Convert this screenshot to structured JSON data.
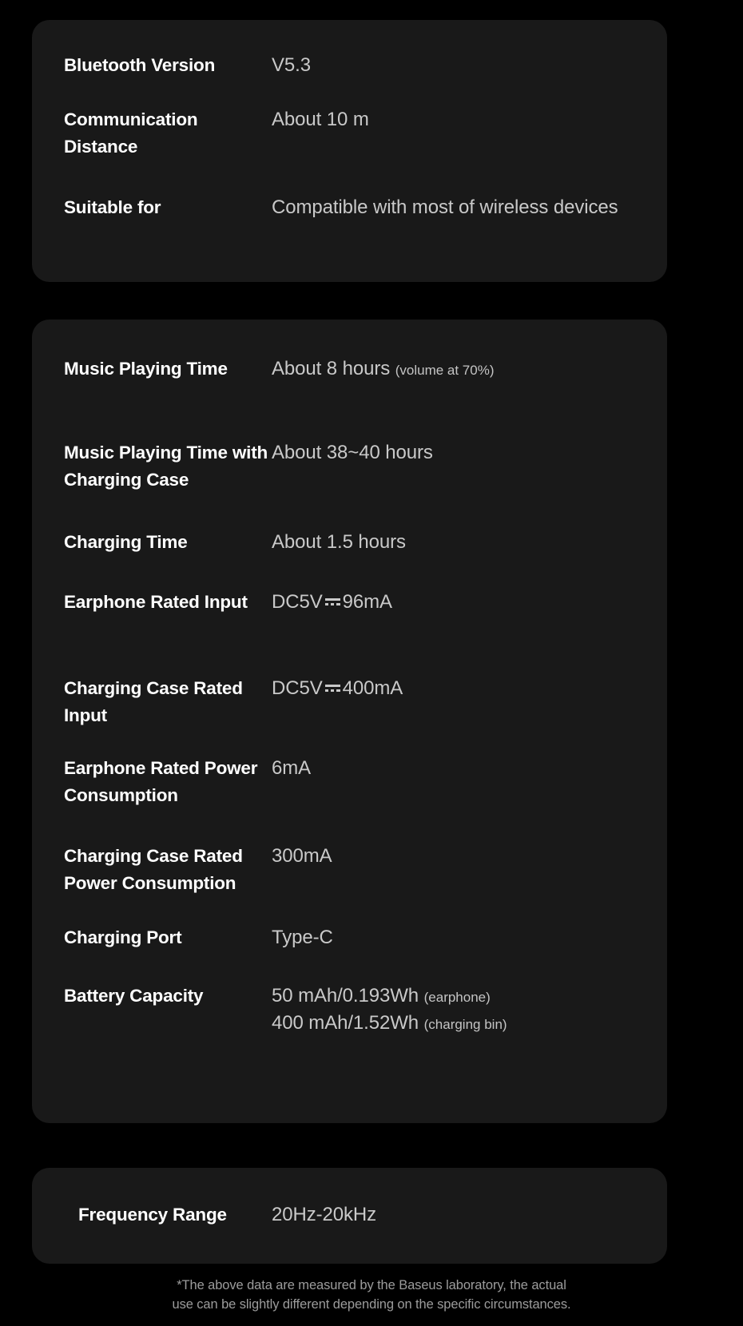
{
  "cards": {
    "specs": {
      "rows": [
        {
          "label": "Bluetooth Version",
          "value": "V5.3"
        },
        {
          "label": "Communication Distance",
          "value": "About 10 m"
        },
        {
          "label": "Suitable for",
          "value": "Compatible with most of wireless devices"
        }
      ]
    },
    "battery": {
      "rows": [
        {
          "label": "Music Playing Time",
          "value": "About 8 hours",
          "note": "(volume at 70%)"
        },
        {
          "label": "Music Playing Time with Charging Case",
          "value": "About 38~40 hours"
        },
        {
          "label": "Charging Time",
          "value": "About 1.5 hours"
        },
        {
          "label": "Earphone Rated Input",
          "value_prefix": "DC5V",
          "value_suffix": "96mA",
          "dc_symbol": "direct-current-mark"
        },
        {
          "label": "Charging Case Rated Input",
          "value_prefix": "DC5V",
          "value_suffix": "400mA",
          "dc_symbol": "direct-current-mark"
        },
        {
          "label": "Earphone Rated Power Consumption",
          "value": "6mA"
        },
        {
          "label": "Charging Case Rated Power Consumption",
          "value": "300mA"
        },
        {
          "label": "Charging Port",
          "value": "Type-C"
        },
        {
          "label": "Battery Capacity",
          "line1_value": "50 mAh/0.193Wh",
          "line1_note": "(earphone)",
          "line2_value": "400 mAh/1.52Wh",
          "line2_note": "(charging bin)"
        }
      ]
    },
    "frequency": {
      "rows": [
        {
          "label": "Frequency Range",
          "value": "20Hz-20kHz"
        }
      ]
    }
  },
  "footnote": {
    "line1": "*The above data are measured by the Baseus laboratory, the actual",
    "line2": "use can be slightly different depending on the specific circumstances."
  },
  "colors": {
    "page_background": "#000000",
    "card_background": "#191919",
    "label_text": "#ffffff",
    "value_text": "#c9c9c9",
    "footnote_text": "#9c9c9c"
  }
}
